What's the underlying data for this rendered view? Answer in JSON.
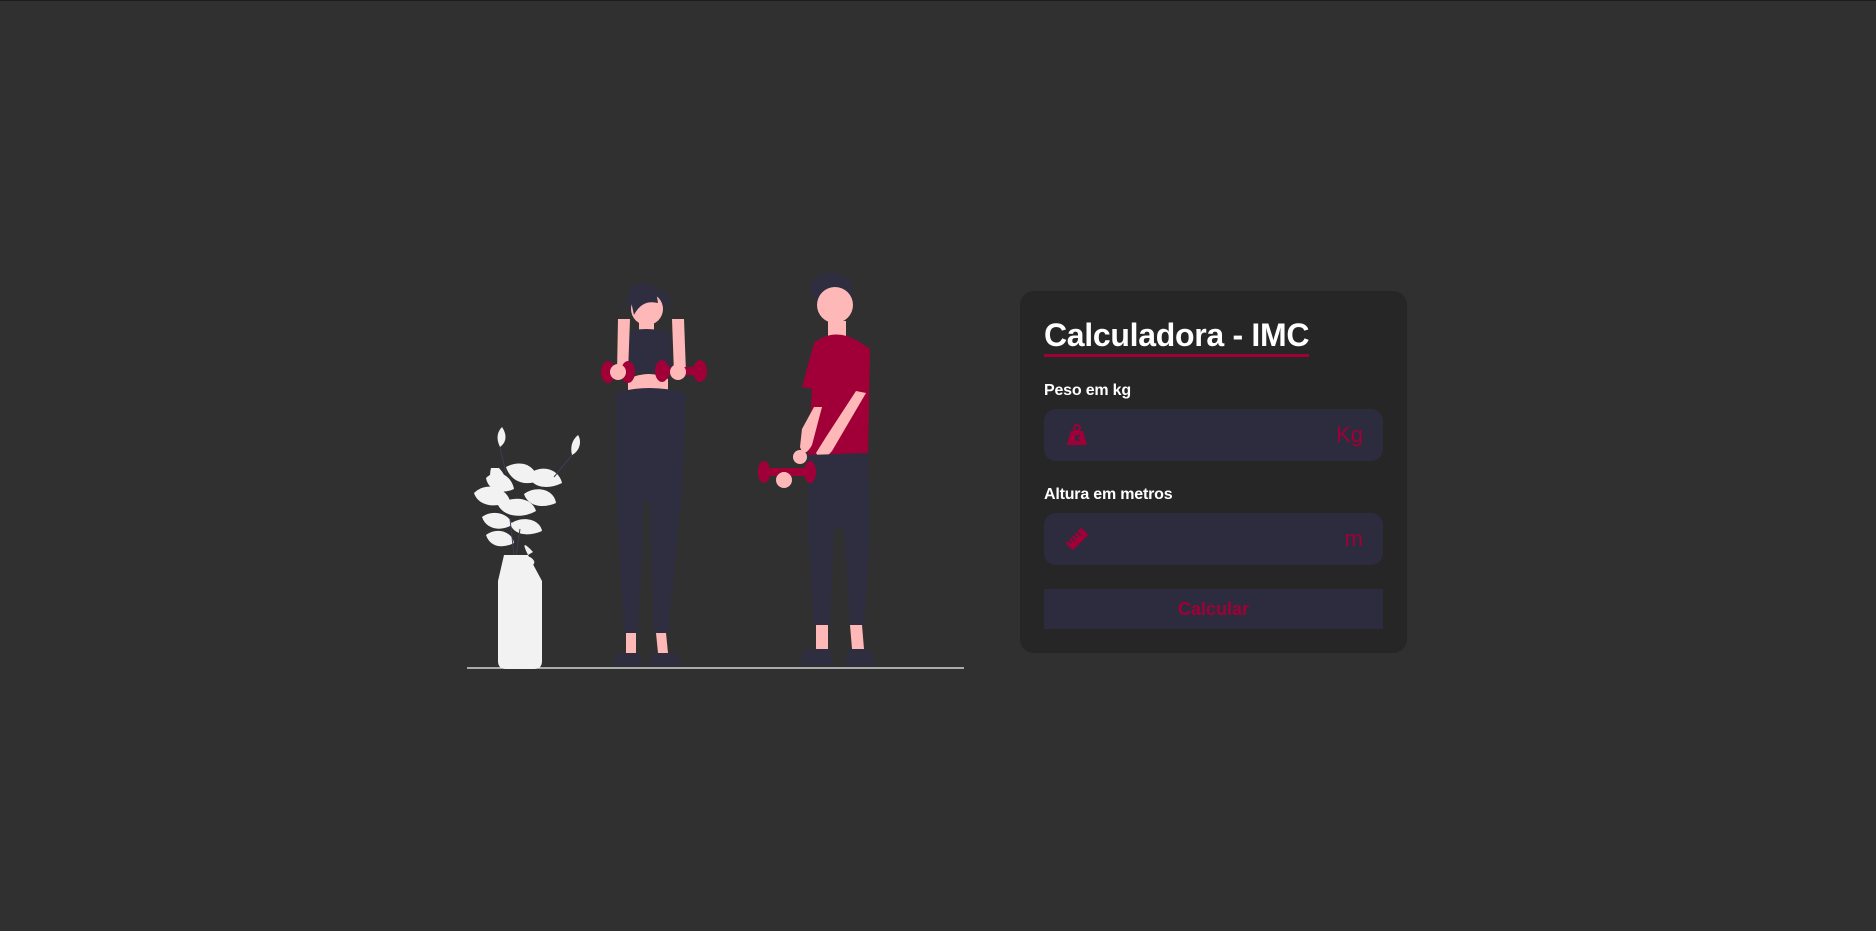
{
  "app": {
    "title": "Calculadora - IMC"
  },
  "form": {
    "weight": {
      "label": "Peso em kg",
      "value": "",
      "placeholder": "",
      "unit": "Kg",
      "icon": "weight-icon"
    },
    "height": {
      "label": "Altura em metros",
      "value": "",
      "placeholder": "",
      "unit": "m",
      "icon": "ruler-icon"
    },
    "submit_label": "Calcular"
  },
  "colors": {
    "background": "#303030",
    "card": "#262626",
    "input": "#2d2b3e",
    "accent": "#a00037",
    "text": "#ffffff",
    "skin": "#ffb8b8",
    "dark_figure": "#2f2e41",
    "plant": "#f2f2f2"
  },
  "illustration": {
    "name": "fitness-illustration",
    "icons": [
      "woman-figure",
      "man-figure",
      "plant",
      "dumbbell-icon"
    ]
  }
}
